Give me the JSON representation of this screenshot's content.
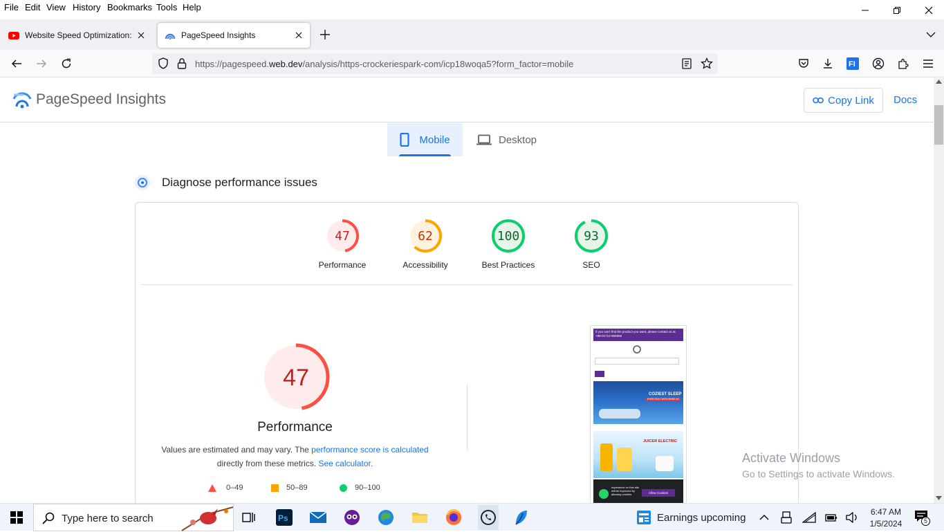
{
  "menu": {
    "items": [
      "File",
      "Edit",
      "View",
      "History",
      "Bookmarks",
      "Tools",
      "Help"
    ]
  },
  "tabs": [
    {
      "title": "Website Speed Optimization: H",
      "active": false
    },
    {
      "title": "PageSpeed Insights",
      "active": true
    }
  ],
  "nav": {
    "url_prefix": "https://pagespeed.",
    "url_domain": "web.dev",
    "url_path": "/analysis/https-crockeriespark-com/icp18woqa5?form_factor=mobile"
  },
  "psi": {
    "brand": "PageSpeed Insights",
    "copy_link": "Copy Link",
    "docs": "Docs",
    "tab_mobile": "Mobile",
    "tab_desktop": "Desktop",
    "diagnose_title": "Diagnose performance issues",
    "scores": [
      {
        "value": "47",
        "label": "Performance",
        "status": "fail",
        "fraction": 0.47
      },
      {
        "value": "62",
        "label": "Accessibility",
        "status": "average",
        "fraction": 0.62
      },
      {
        "value": "100",
        "label": "Best Practices",
        "status": "pass",
        "fraction": 1.0
      },
      {
        "value": "93",
        "label": "SEO",
        "status": "pass",
        "fraction": 0.93
      }
    ],
    "big_score": {
      "value": "47",
      "label": "Performance",
      "fraction": 0.47
    },
    "note": {
      "part1": "Values are estimated and may vary. The ",
      "link1": "performance score is calculated",
      "part2": "directly from these metrics. ",
      "link2": "See calculator."
    },
    "legend": [
      {
        "range": "0–49",
        "shape": "triangle",
        "color": "#ff4e42"
      },
      {
        "range": "50–89",
        "shape": "square",
        "color": "#ffa400"
      },
      {
        "range": "90–100",
        "shape": "circle",
        "color": "#0cce6b"
      }
    ],
    "screenshot": {
      "banner": "If you can't find the product you want, please contact us at +88-01712-966666",
      "ad1": "COZIEST SLEEP",
      "ad1_sub": "EVER ONLY WITH GREE AC",
      "ad2": "JUICER ELECTRIC",
      "cookie_text": "experience on this site will be improved by allowing cookies.",
      "cookie_btn": "Allow Cookies"
    }
  },
  "watermark": {
    "line1": "Activate Windows",
    "line2": "Go to Settings to activate Windows."
  },
  "taskbar": {
    "search_placeholder": "Type here to search",
    "news": "Earnings upcoming",
    "time": "6:47 AM",
    "date": "1/5/2024",
    "notifications": "5"
  },
  "colors": {
    "fail": "#c5221f",
    "fail_ring": "#ff4e42",
    "average": "#c33300",
    "average_ring": "#ffa400",
    "pass": "#0d652d",
    "pass_ring": "#0cce6b",
    "link": "#1a73e8"
  }
}
